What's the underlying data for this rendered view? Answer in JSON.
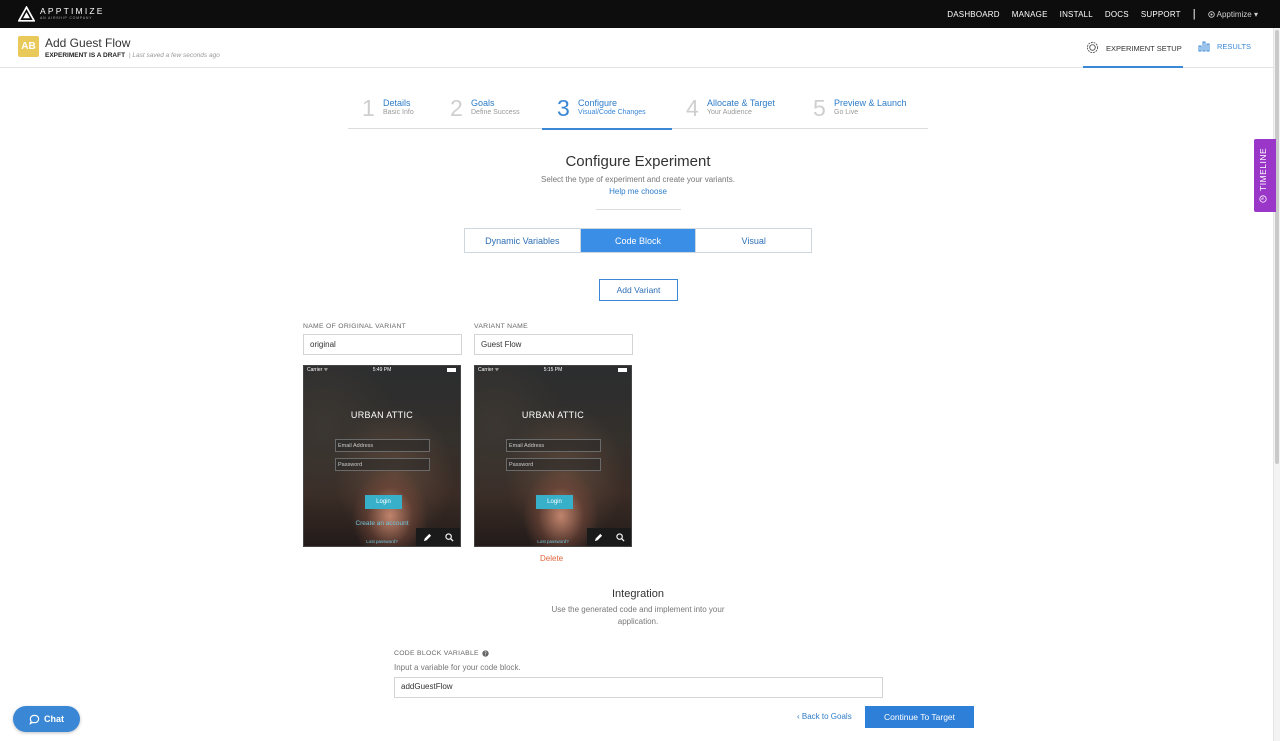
{
  "topnav": {
    "brand": "APPTIMIZE",
    "brand_sub": "AN AIRSHIP COMPANY",
    "links": [
      "DASHBOARD",
      "MANAGE",
      "INSTALL",
      "DOCS",
      "SUPPORT"
    ],
    "account": "Apptimize ▾"
  },
  "header": {
    "badge": "AB",
    "title": "Add Guest Flow",
    "status": "EXPERIMENT IS A DRAFT",
    "saved": "| Last saved a few seconds ago",
    "tab_setup": "EXPERIMENT SETUP",
    "tab_results": "RESULTS",
    "timeline": "TIMELINE"
  },
  "steps": [
    {
      "num": "1",
      "label": "Details",
      "sub": "Basic Info"
    },
    {
      "num": "2",
      "label": "Goals",
      "sub": "Define Success"
    },
    {
      "num": "3",
      "label": "Configure",
      "sub": "Visual/Code Changes"
    },
    {
      "num": "4",
      "label": "Allocate & Target",
      "sub": "Your Audience"
    },
    {
      "num": "5",
      "label": "Preview & Launch",
      "sub": "Go Live"
    }
  ],
  "configure": {
    "title": "Configure Experiment",
    "subtitle": "Select the type of experiment and create your variants.",
    "help": "Help me choose",
    "types": [
      "Dynamic Variables",
      "Code Block",
      "Visual"
    ],
    "selected_type": "Code Block",
    "add_variant": "Add Variant"
  },
  "variants": {
    "original_label": "NAME OF ORIGINAL VARIANT",
    "original_value": "original",
    "variant_label": "VARIANT NAME",
    "variant_value": "Guest Flow",
    "delete": "Delete",
    "original_screen": {
      "carrier": "Carrier ᯤ",
      "time": "5:49 PM",
      "brand": "URBAN ATTIC",
      "email": "Email Address",
      "password": "Password",
      "login": "Login",
      "create": "Create an account",
      "lost": "Lost password?"
    },
    "variant_screen": {
      "carrier": "Carrier ᯤ",
      "time": "5:15 PM",
      "brand": "URBAN ATTIC",
      "email": "Email Address",
      "password": "Password",
      "login": "Login",
      "lost": "Lost password?"
    }
  },
  "integration": {
    "title": "Integration",
    "subtitle": "Use the generated code and implement into your application.",
    "cb_label": "CODE BLOCK VARIABLE",
    "cb_help": "Input a variable for your code block.",
    "cb_value": "addGuestFlow"
  },
  "footer": {
    "back": "Back to Goals",
    "continue": "Continue To Target",
    "chat": "Chat"
  },
  "colors": {
    "accent": "#3a87d6",
    "timeline": "#9a37c8",
    "badge": "#e8c95a",
    "delete": "#e2663b"
  }
}
